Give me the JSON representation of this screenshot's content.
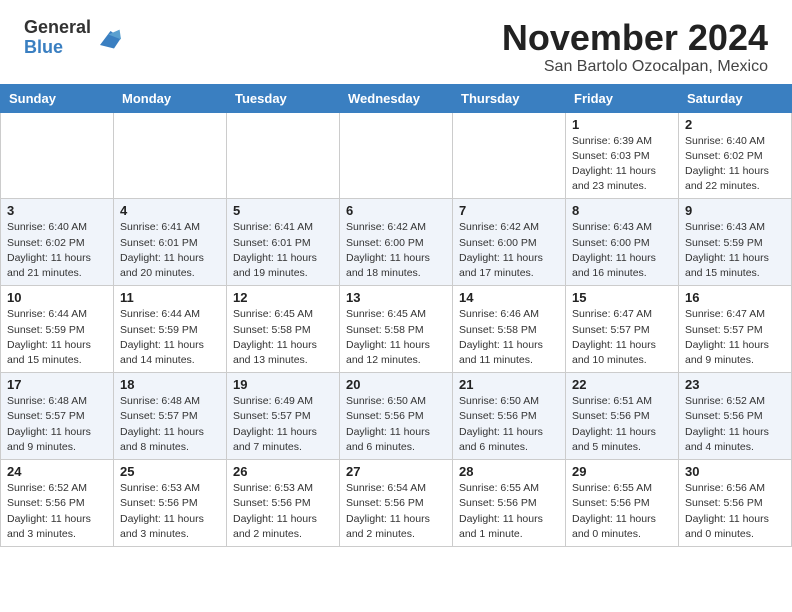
{
  "header": {
    "logo_general": "General",
    "logo_blue": "Blue",
    "month_title": "November 2024",
    "subtitle": "San Bartolo Ozocalpan, Mexico"
  },
  "weekdays": [
    "Sunday",
    "Monday",
    "Tuesday",
    "Wednesday",
    "Thursday",
    "Friday",
    "Saturday"
  ],
  "weeks": [
    [
      {
        "day": "",
        "info": ""
      },
      {
        "day": "",
        "info": ""
      },
      {
        "day": "",
        "info": ""
      },
      {
        "day": "",
        "info": ""
      },
      {
        "day": "",
        "info": ""
      },
      {
        "day": "1",
        "info": "Sunrise: 6:39 AM\nSunset: 6:03 PM\nDaylight: 11 hours and 23 minutes."
      },
      {
        "day": "2",
        "info": "Sunrise: 6:40 AM\nSunset: 6:02 PM\nDaylight: 11 hours and 22 minutes."
      }
    ],
    [
      {
        "day": "3",
        "info": "Sunrise: 6:40 AM\nSunset: 6:02 PM\nDaylight: 11 hours and 21 minutes."
      },
      {
        "day": "4",
        "info": "Sunrise: 6:41 AM\nSunset: 6:01 PM\nDaylight: 11 hours and 20 minutes."
      },
      {
        "day": "5",
        "info": "Sunrise: 6:41 AM\nSunset: 6:01 PM\nDaylight: 11 hours and 19 minutes."
      },
      {
        "day": "6",
        "info": "Sunrise: 6:42 AM\nSunset: 6:00 PM\nDaylight: 11 hours and 18 minutes."
      },
      {
        "day": "7",
        "info": "Sunrise: 6:42 AM\nSunset: 6:00 PM\nDaylight: 11 hours and 17 minutes."
      },
      {
        "day": "8",
        "info": "Sunrise: 6:43 AM\nSunset: 6:00 PM\nDaylight: 11 hours and 16 minutes."
      },
      {
        "day": "9",
        "info": "Sunrise: 6:43 AM\nSunset: 5:59 PM\nDaylight: 11 hours and 15 minutes."
      }
    ],
    [
      {
        "day": "10",
        "info": "Sunrise: 6:44 AM\nSunset: 5:59 PM\nDaylight: 11 hours and 15 minutes."
      },
      {
        "day": "11",
        "info": "Sunrise: 6:44 AM\nSunset: 5:59 PM\nDaylight: 11 hours and 14 minutes."
      },
      {
        "day": "12",
        "info": "Sunrise: 6:45 AM\nSunset: 5:58 PM\nDaylight: 11 hours and 13 minutes."
      },
      {
        "day": "13",
        "info": "Sunrise: 6:45 AM\nSunset: 5:58 PM\nDaylight: 11 hours and 12 minutes."
      },
      {
        "day": "14",
        "info": "Sunrise: 6:46 AM\nSunset: 5:58 PM\nDaylight: 11 hours and 11 minutes."
      },
      {
        "day": "15",
        "info": "Sunrise: 6:47 AM\nSunset: 5:57 PM\nDaylight: 11 hours and 10 minutes."
      },
      {
        "day": "16",
        "info": "Sunrise: 6:47 AM\nSunset: 5:57 PM\nDaylight: 11 hours and 9 minutes."
      }
    ],
    [
      {
        "day": "17",
        "info": "Sunrise: 6:48 AM\nSunset: 5:57 PM\nDaylight: 11 hours and 9 minutes."
      },
      {
        "day": "18",
        "info": "Sunrise: 6:48 AM\nSunset: 5:57 PM\nDaylight: 11 hours and 8 minutes."
      },
      {
        "day": "19",
        "info": "Sunrise: 6:49 AM\nSunset: 5:57 PM\nDaylight: 11 hours and 7 minutes."
      },
      {
        "day": "20",
        "info": "Sunrise: 6:50 AM\nSunset: 5:56 PM\nDaylight: 11 hours and 6 minutes."
      },
      {
        "day": "21",
        "info": "Sunrise: 6:50 AM\nSunset: 5:56 PM\nDaylight: 11 hours and 6 minutes."
      },
      {
        "day": "22",
        "info": "Sunrise: 6:51 AM\nSunset: 5:56 PM\nDaylight: 11 hours and 5 minutes."
      },
      {
        "day": "23",
        "info": "Sunrise: 6:52 AM\nSunset: 5:56 PM\nDaylight: 11 hours and 4 minutes."
      }
    ],
    [
      {
        "day": "24",
        "info": "Sunrise: 6:52 AM\nSunset: 5:56 PM\nDaylight: 11 hours and 3 minutes."
      },
      {
        "day": "25",
        "info": "Sunrise: 6:53 AM\nSunset: 5:56 PM\nDaylight: 11 hours and 3 minutes."
      },
      {
        "day": "26",
        "info": "Sunrise: 6:53 AM\nSunset: 5:56 PM\nDaylight: 11 hours and 2 minutes."
      },
      {
        "day": "27",
        "info": "Sunrise: 6:54 AM\nSunset: 5:56 PM\nDaylight: 11 hours and 2 minutes."
      },
      {
        "day": "28",
        "info": "Sunrise: 6:55 AM\nSunset: 5:56 PM\nDaylight: 11 hours and 1 minute."
      },
      {
        "day": "29",
        "info": "Sunrise: 6:55 AM\nSunset: 5:56 PM\nDaylight: 11 hours and 0 minutes."
      },
      {
        "day": "30",
        "info": "Sunrise: 6:56 AM\nSunset: 5:56 PM\nDaylight: 11 hours and 0 minutes."
      }
    ]
  ]
}
